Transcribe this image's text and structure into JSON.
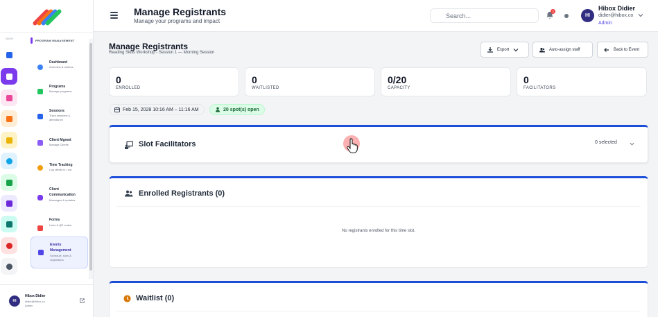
{
  "colors": {
    "accent": "#4f46e5",
    "panel_border": "#1d4ed8",
    "success": "#166534"
  },
  "sidebar": {
    "menu_label": "MAIN",
    "section_title": "PROGRAM MANAGEMENT",
    "rail_icons": [
      "home-icon",
      "sitemap-icon",
      "leaf-icon",
      "clipboard-icon",
      "ticket-icon",
      "target-icon",
      "flow-icon",
      "report-icon",
      "users-icon",
      "pie-icon",
      "settings-icon"
    ],
    "items": [
      {
        "title": "Dashboard",
        "sub1": "Overview & metrics",
        "sub2": ""
      },
      {
        "title": "Programs",
        "sub1": "Manage programs",
        "sub2": ""
      },
      {
        "title": "Sessions",
        "sub1": "Track sessions &",
        "sub2": "attendance"
      },
      {
        "title": "Client Mgmnt",
        "sub1": "Manage Clients",
        "sub2": ""
      },
      {
        "title": "Time Tracking",
        "sub1": "Log clients in / out",
        "sub2": ""
      },
      {
        "title": "Client",
        "title2": "Communication",
        "sub1": "Messages & updates",
        "sub2": ""
      },
      {
        "title": "Forms",
        "sub1": "Links & QR codes",
        "sub2": ""
      },
      {
        "title": "Events",
        "title2": "Management",
        "sub1": "Schedule, slots &",
        "sub2": "registration"
      }
    ],
    "profile": {
      "initials": "HI",
      "name": "Hibox Didier",
      "email": "didier@hibox.co",
      "role": "Admin"
    }
  },
  "header": {
    "title": "Manage Registrants",
    "subtitle": "Manage your programs and impact",
    "search_placeholder": "Search...",
    "notification_count": "3",
    "user": {
      "initials": "HI",
      "name": "Hibox Didier",
      "email": "didier@hibox.co",
      "role": "Admin"
    }
  },
  "page": {
    "title": "Manage Registrants",
    "subtitle": "Reading Skills Workshop - Session 1 — Morning Session",
    "buttons": {
      "export": "Export",
      "auto_assign": "Auto-assign staff",
      "back": "Back to Event"
    }
  },
  "stats": [
    {
      "value": "0",
      "label": "ENROLLED"
    },
    {
      "value": "0",
      "label": "WAITLISTED"
    },
    {
      "value": "0/20",
      "label": "CAPACITY"
    },
    {
      "value": "0",
      "label": "FACILITATORS"
    }
  ],
  "slot": {
    "date": "Feb 15, 2028 10:16 AM – 11:16 AM",
    "spots": "20 spot(s) open"
  },
  "facilitators": {
    "title": "Slot Facilitators",
    "selected": "0 selected"
  },
  "enrolled": {
    "title": "Enrolled Registrants (0)",
    "empty": "No registrants enrolled for this time slot."
  },
  "waitlist": {
    "title": "Waitlist (0)"
  }
}
